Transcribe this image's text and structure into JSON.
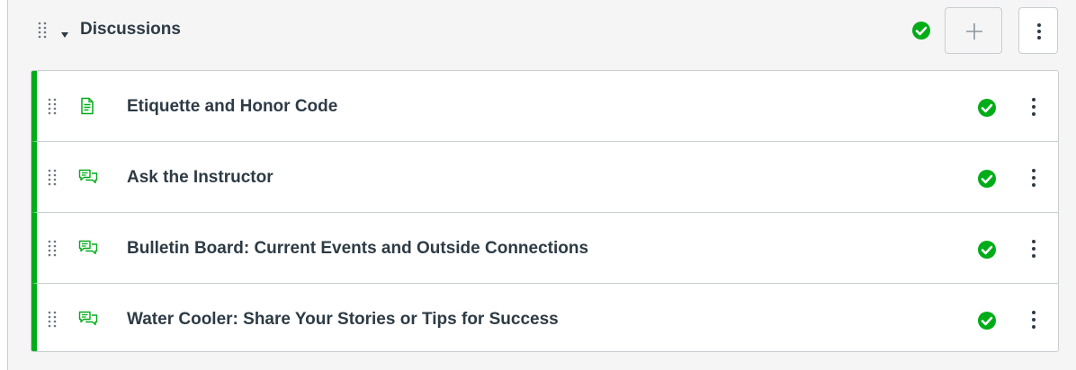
{
  "module": {
    "title": "Discussions",
    "published": true,
    "add_label": "+",
    "accent_color": "#00ac18",
    "items": [
      {
        "title": "Etiquette and Honor Code",
        "type_icon": "page-icon",
        "published": true
      },
      {
        "title": "Ask the Instructor",
        "type_icon": "discussion-icon",
        "published": true
      },
      {
        "title": "Bulletin Board: Current Events and Outside Connections",
        "type_icon": "discussion-icon",
        "published": true
      },
      {
        "title": "Water Cooler: Share Your Stories or Tips for Success",
        "type_icon": "discussion-icon",
        "published": true
      }
    ]
  }
}
